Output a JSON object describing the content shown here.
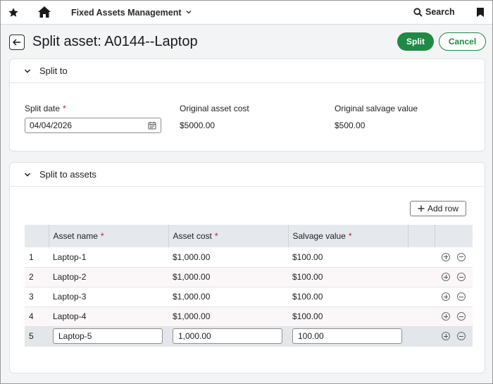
{
  "nav": {
    "app_name": "Fixed Assets Management",
    "search_label": "Search"
  },
  "header": {
    "title": "Split asset: A0144--Laptop",
    "split_label": "Split",
    "cancel_label": "Cancel"
  },
  "split_to": {
    "section_title": "Split to",
    "split_date_label": "Split date",
    "split_date_value": "04/04/2026",
    "original_cost_label": "Original asset cost",
    "original_cost_value": "$5000.00",
    "original_salvage_label": "Original salvage value",
    "original_salvage_value": "$500.00"
  },
  "split_to_assets": {
    "section_title": "Split to assets",
    "add_row_label": "Add row",
    "columns": {
      "asset_name": "Asset name",
      "asset_cost": "Asset cost",
      "salvage_value": "Salvage value"
    },
    "rows": [
      {
        "num": "1",
        "name": "Laptop-1",
        "cost": "$1,000.00",
        "salvage": "$100.00"
      },
      {
        "num": "2",
        "name": "Laptop-2",
        "cost": "$1,000.00",
        "salvage": "$100.00"
      },
      {
        "num": "3",
        "name": "Laptop-3",
        "cost": "$1,000.00",
        "salvage": "$100.00"
      },
      {
        "num": "4",
        "name": "Laptop-4",
        "cost": "$1,000.00",
        "salvage": "$100.00"
      },
      {
        "num": "5",
        "name": "Laptop-5",
        "cost": "1,000.00",
        "salvage": "100.00"
      }
    ]
  },
  "colors": {
    "accent_green": "#1e8a45",
    "required_red": "#c8102e",
    "table_header_bg": "#e5e8ec"
  },
  "icons": [
    "star-icon",
    "home-icon",
    "chevron-down-icon",
    "search-icon",
    "bookmark-icon",
    "back-arrow-icon",
    "calendar-icon",
    "plus-icon",
    "add-circle-icon",
    "remove-circle-icon"
  ]
}
